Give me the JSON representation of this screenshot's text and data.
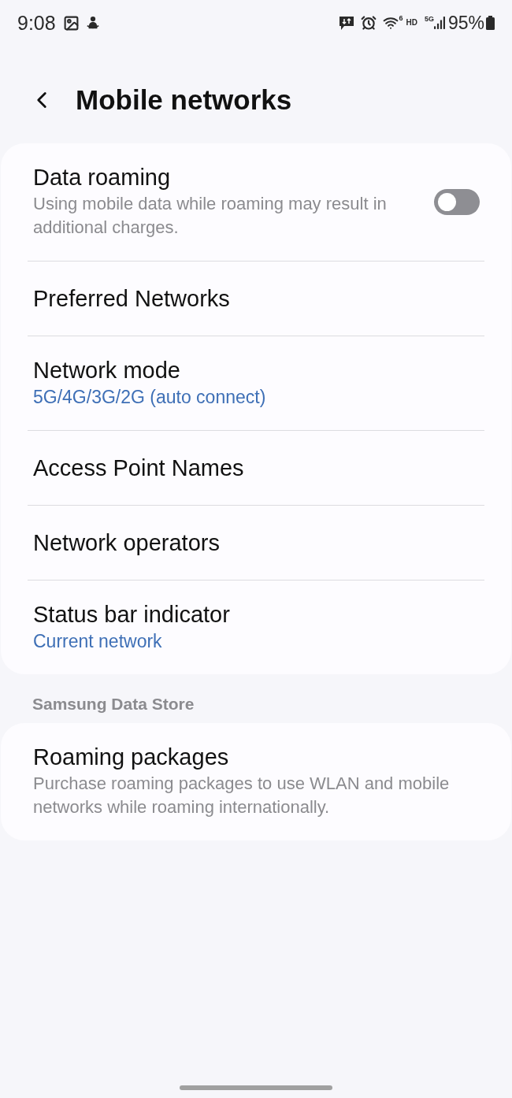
{
  "status_bar": {
    "time": "9:08",
    "wifi_badge": "6",
    "hd": "HD",
    "network_type": "5G",
    "battery": "95%"
  },
  "header": {
    "title": "Mobile networks"
  },
  "groups": [
    {
      "items": [
        {
          "kind": "toggle",
          "title": "Data roaming",
          "summary": "Using mobile data while roaming may result in additional charges.",
          "on": false
        },
        {
          "kind": "link",
          "title": "Preferred Networks"
        },
        {
          "kind": "value",
          "title": "Network mode",
          "value": "5G/4G/3G/2G (auto connect)"
        },
        {
          "kind": "link",
          "title": "Access Point Names"
        },
        {
          "kind": "link",
          "title": "Network operators"
        },
        {
          "kind": "value",
          "title": "Status bar indicator",
          "value": "Current network"
        }
      ]
    },
    {
      "header": "Samsung Data Store",
      "items": [
        {
          "kind": "info",
          "title": "Roaming packages",
          "summary": "Purchase roaming packages to use WLAN and mobile networks while roaming internationally."
        }
      ]
    }
  ]
}
